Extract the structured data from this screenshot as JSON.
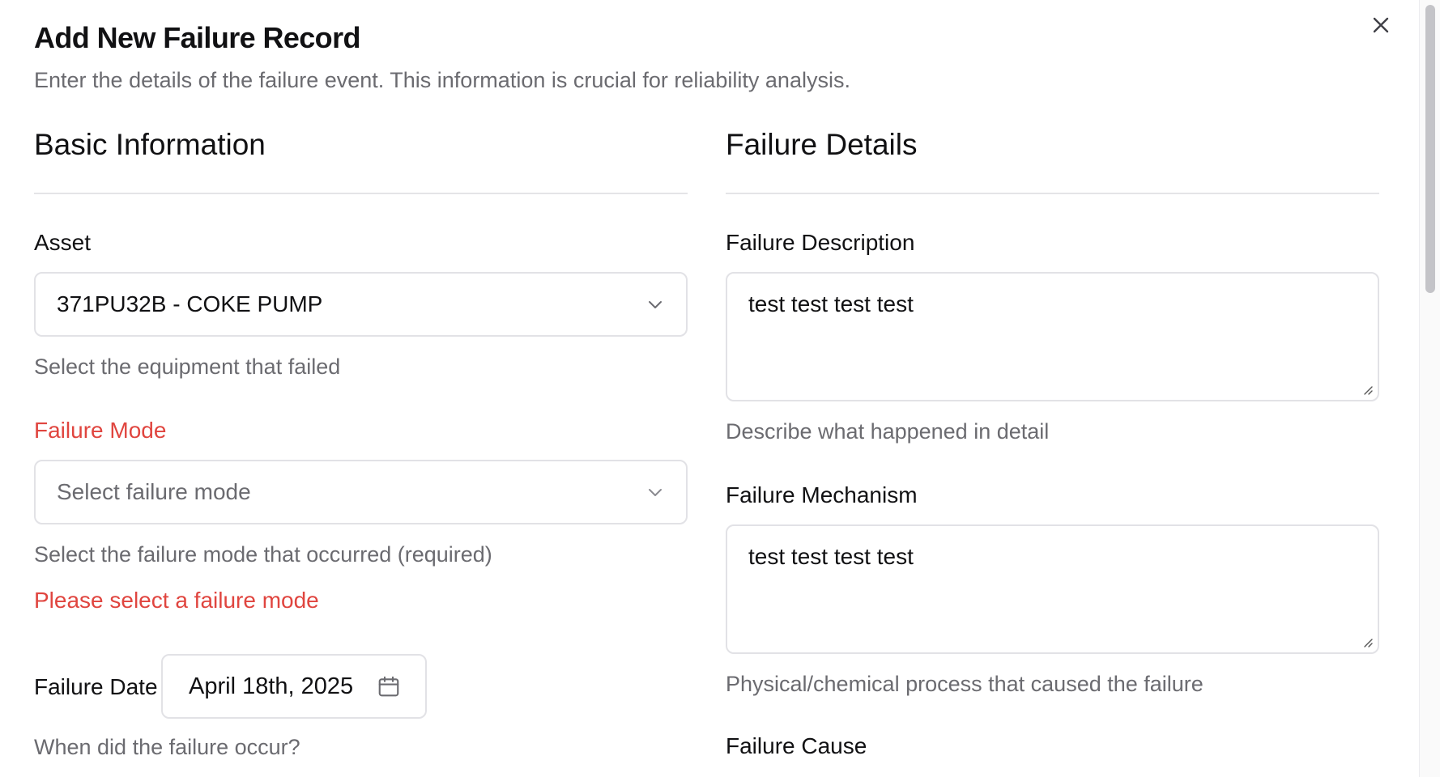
{
  "dialog": {
    "title": "Add New Failure Record",
    "subtitle": "Enter the details of the failure event. This information is crucial for reliability analysis.",
    "close_icon": "close-icon"
  },
  "basic_info": {
    "section_title": "Basic Information",
    "asset": {
      "label": "Asset",
      "value": "371PU32B - COKE PUMP",
      "hint": "Select the equipment that failed",
      "icon": "chevron-down-icon"
    },
    "failure_mode": {
      "label": "Failure Mode",
      "placeholder": "Select failure mode",
      "hint": "Select the failure mode that occurred (required)",
      "error": "Please select a failure mode",
      "icon": "chevron-down-icon"
    },
    "failure_date": {
      "label": "Failure Date",
      "value": "April 18th, 2025",
      "hint": "When did the failure occur?",
      "icon": "calendar-icon"
    }
  },
  "failure_details": {
    "section_title": "Failure Details",
    "description": {
      "label": "Failure Description",
      "value": "test test test test",
      "hint": "Describe what happened in detail"
    },
    "mechanism": {
      "label": "Failure Mechanism",
      "value": "test test test test",
      "hint": "Physical/chemical process that caused the failure"
    },
    "cause": {
      "label": "Failure Cause"
    }
  },
  "colors": {
    "error": "#e0453f",
    "muted_text": "#6b6b70",
    "border": "#e2e2e6"
  }
}
